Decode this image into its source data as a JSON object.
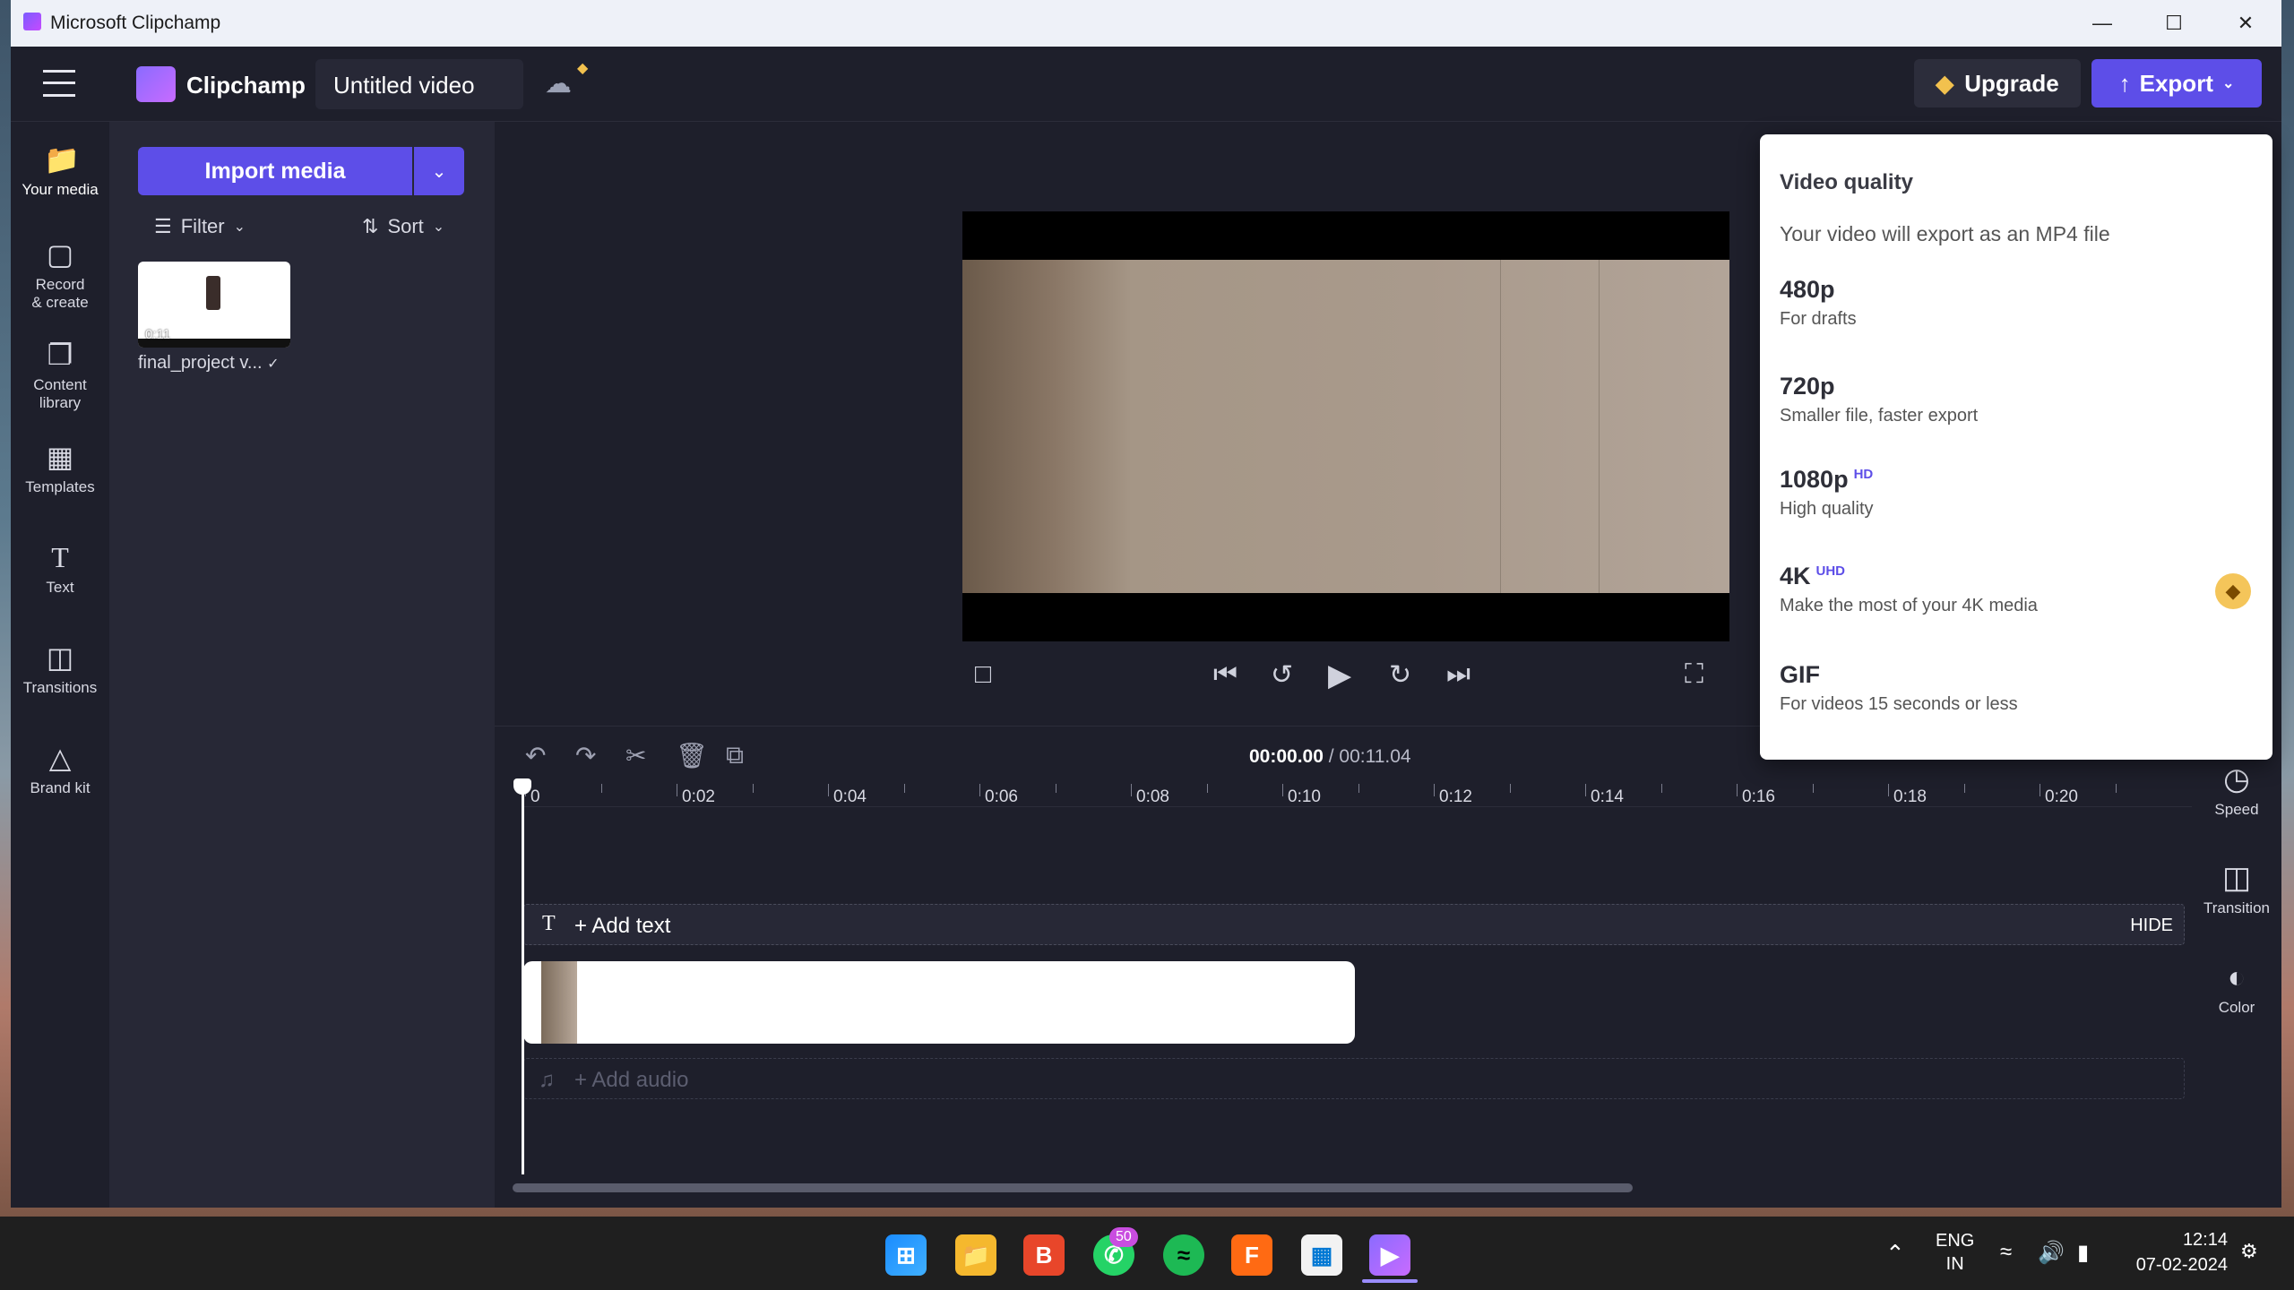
{
  "window": {
    "title": "Microsoft Clipchamp"
  },
  "header": {
    "brand": "Clipchamp",
    "project_name": "Untitled video",
    "upgrade_label": "Upgrade",
    "export_label": "Export"
  },
  "leftnav": [
    {
      "label": "Your media",
      "icon": "folder-icon"
    },
    {
      "label": "Record & create",
      "icon": "camera-icon"
    },
    {
      "label": "Content library",
      "icon": "library-icon"
    },
    {
      "label": "Templates",
      "icon": "templates-icon"
    },
    {
      "label": "Text",
      "icon": "text-icon"
    },
    {
      "label": "Transitions",
      "icon": "transitions-icon"
    },
    {
      "label": "Brand kit",
      "icon": "brand-kit-icon"
    }
  ],
  "media": {
    "import_label": "Import media",
    "filter_label": "Filter",
    "sort_label": "Sort",
    "item_name": "final_project v...",
    "item_duration": "0:11"
  },
  "timeline": {
    "current": "00:00.00",
    "total": "/ 00:11.04",
    "ticks": [
      "0",
      "0:02",
      "0:04",
      "0:06",
      "0:08",
      "0:10",
      "0:12",
      "0:14",
      "0:16",
      "0:18",
      "0:20"
    ],
    "add_text": "+ Add text",
    "hide": "HIDE",
    "add_audio": "+ Add audio"
  },
  "rightrail": [
    {
      "label": "Speed"
    },
    {
      "label": "Transition"
    },
    {
      "label": "Color"
    }
  ],
  "export_menu": {
    "heading": "Video quality",
    "subtitle": "Your video will export as an MP4 file",
    "options": [
      {
        "name": "480p",
        "badge": "",
        "desc": "For drafts"
      },
      {
        "name": "720p",
        "badge": "",
        "desc": "Smaller file, faster export"
      },
      {
        "name": "1080p",
        "badge": "HD",
        "desc": "High quality"
      },
      {
        "name": "4K",
        "badge": "UHD",
        "desc": "Make the most of your 4K media"
      },
      {
        "name": "GIF",
        "badge": "",
        "desc": "For videos 15 seconds or less"
      }
    ]
  },
  "taskbar": {
    "whatsapp_badge": "50",
    "lang_top": "ENG",
    "lang_bottom": "IN",
    "time": "12:14",
    "date": "07-02-2024"
  },
  "colors": {
    "accent": "#5d4ee8",
    "bg": "#1e1f2b",
    "panel": "#272836"
  }
}
